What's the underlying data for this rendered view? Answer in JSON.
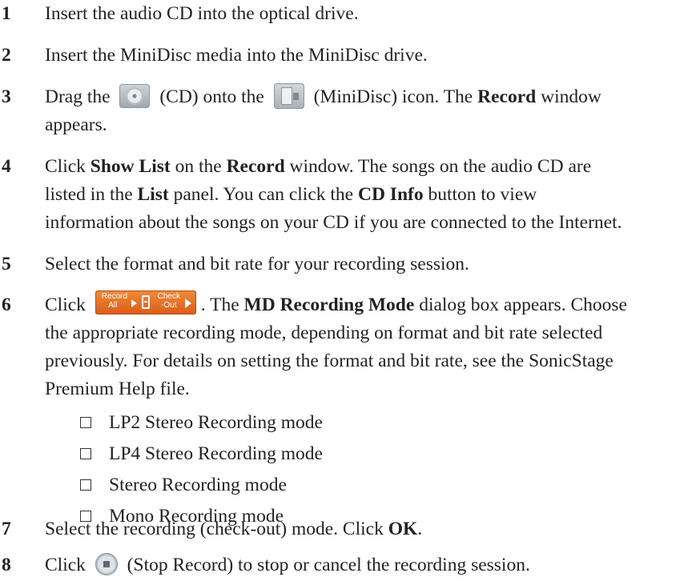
{
  "steps": [
    {
      "num": "1",
      "text": "Insert the audio CD into the optical drive."
    },
    {
      "num": "2",
      "text": "Insert the MiniDisc media into the MiniDisc drive."
    },
    {
      "num": "3",
      "pre": "Drag the",
      "cd_label": "(CD) onto the",
      "md_label": "(MiniDisc) icon. The",
      "bold1": "Record",
      "post": "window",
      "line2": "appears."
    },
    {
      "num": "4",
      "a": "Click",
      "b1": "Show List",
      "c": "on the",
      "b2": "Record",
      "d": "window. The songs on the audio CD are",
      "e": "listed in the",
      "b3": "List",
      "f": "panel. You can click the",
      "b4": "CD Info",
      "g": "button to view",
      "h": "information about the songs on your CD if you are connected to the Internet."
    },
    {
      "num": "5",
      "text": "Select the format and bit rate for your recording session."
    },
    {
      "num": "6",
      "a": "Click",
      "button": {
        "label1_top": "Record",
        "label1_bottom": "All",
        "label2_top": "Check",
        "label2_bottom": "-Out"
      },
      "b": ". The",
      "bold": "MD Recording Mode",
      "c": "dialog box appears. Choose",
      "line2": "the appropriate recording mode, depending on format and bit rate selected",
      "line3": "previously. For details on setting the format and bit rate, see the SonicStage",
      "line4": "Premium Help file."
    },
    {
      "num": "7",
      "a": "Select the recording (check-out) mode. Click",
      "bold": "OK",
      "b": "."
    },
    {
      "num": "8",
      "a": "Click",
      "b": "(Stop Record) to stop or cancel the recording session."
    }
  ],
  "modes": [
    "LP2 Stereo Recording mode",
    "LP4 Stereo Recording mode",
    "Stereo Recording mode",
    "Mono Recording mode"
  ],
  "icons": {
    "cd": "cd-icon",
    "minidisc": "minidisc-icon",
    "record_button": "record-checkout-button-icon",
    "stop_record": "stop-record-icon"
  },
  "colors": {
    "record_button": "#e06b23"
  }
}
